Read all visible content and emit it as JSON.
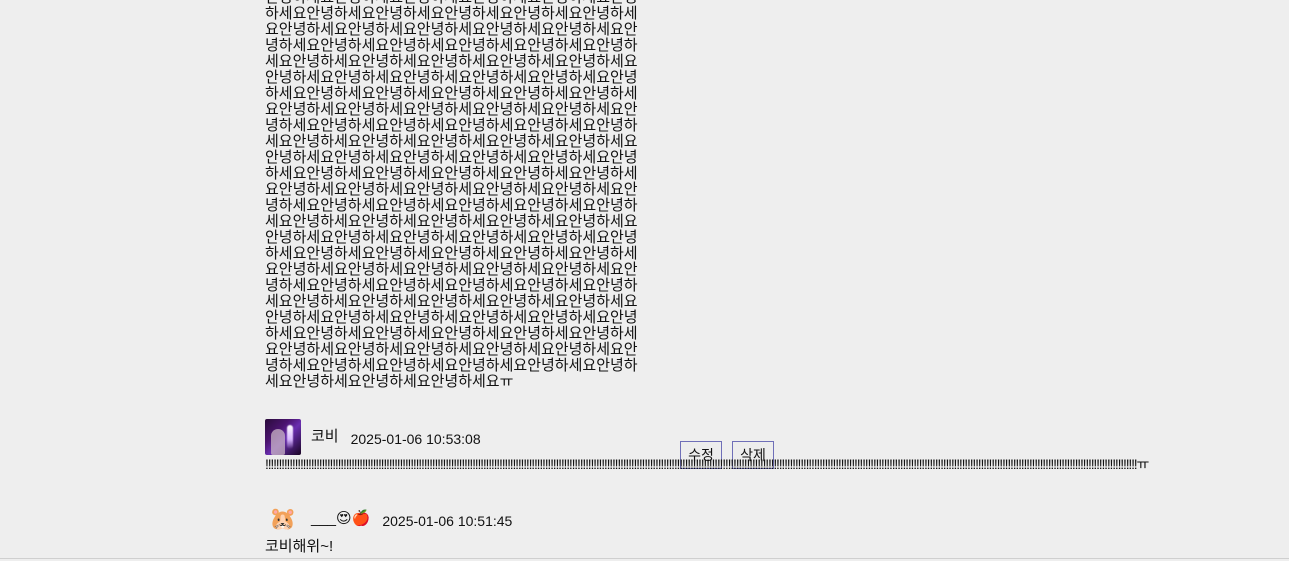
{
  "post": {
    "body": "안녕하세요안녕하세요안녕하세요안녕하세요안녕하세요안녕하세요안녕하세요안녕하세요안녕하세요안녕하세요안녕하세요안녕하세요안녕하세요안녕하세요안녕하세요안녕하세요안녕하세요안녕하세요안녕하세요안녕하세요안녕하세요안녕하세요안녕하세요안녕하세요안녕하세요안녕하세요안녕하세요안녕하세요안녕하세요안녕하세요안녕하세요안녕하세요안녕하세요안녕하세요안녕하세요안녕하세요안녕하세요안녕하세요안녕하세요안녕하세요안녕하세요안녕하세요안녕하세요안녕하세요안녕하세요안녕하세요안녕하세요안녕하세요안녕하세요안녕하세요안녕하세요안녕하세요안녕하세요안녕하세요안녕하세요안녕하세요안녕하세요안녕하세요안녕하세요안녕하세요안녕하세요안녕하세요안녕하세요안녕하세요안녕하세요안녕하세요안녕하세요안녕하세요안녕하세요안녕하세요안녕하세요안녕하세요안녕하세요안녕하세요안녕하세요안녕하세요안녕하세요안녕하세요안녕하세요안녕하세요안녕하세요안녕하세요안녕하세요안녕하세요안녕하세요안녕하세요안녕하세요안녕하세요안녕하세요안녕하세요안녕하세요안녕하세요안녕하세요안녕하세요안녕하세요안녕하세요안녕하세요안녕하세요안녕하세요안녕하세요안녕하세요안녕하세요안녕하세요안녕하세요안녕하세요안녕하세요안녕하세요안녕하세요안녕하세요안녕하세요안녕하세요안녕하세요안녕하세요안녕하세요안녕하세요안녕하세요안녕하세요안녕하세요안녕하세요안녕하세요안녕하세요안녕하세요안녕하세요안녕하세요안녕하세요안녕하세요안녕하세요안녕하세요안녕하세요안녕하세요안녕하세요안녕하세요안녕하세요ㅠ"
  },
  "comments": [
    {
      "nickname": "코비",
      "date": "2025-01-06 10:53:08",
      "body": "!!!!!!!!!!!!!!!!!!!!!!!!!!!!!!!!!!!!!!!!!!!!!!!!!!!!!!!!!!!!!!!!!!!!!!!!!!!!!!!!!!!!!!!!!!!!!!!!!!!!!!!!!!!!!!!!!!!!!!!!!!!!!!!!!!!!!!!!!!!!!!!!!!!!!!!!!!!!!!!!!!!!!!!!!!!!!!!!!!!!!!!!!!!!!!!!!!!!!!!!!!!!!!!!!!!!!!!!!!!!!!!!!!!!!!!!!!!!!!!!!!!!!!!!!!!!!!!!!!!!!!!!!!!!!!!!!!!!!!!!!!!!!!!!!!!!!!!!!!!!!!!!!!!!!!!!!!!!!!!!!!!!ㅠ",
      "edit_label": "수정",
      "delete_label": "삭제",
      "avatar_icon": "profile-photo"
    },
    {
      "nickname": "___😍🍎",
      "date": "2025-01-06 10:51:45",
      "body": "코비해위~!",
      "avatar_icon": "hamster-emoji",
      "avatar_glyph": "🐹"
    }
  ]
}
